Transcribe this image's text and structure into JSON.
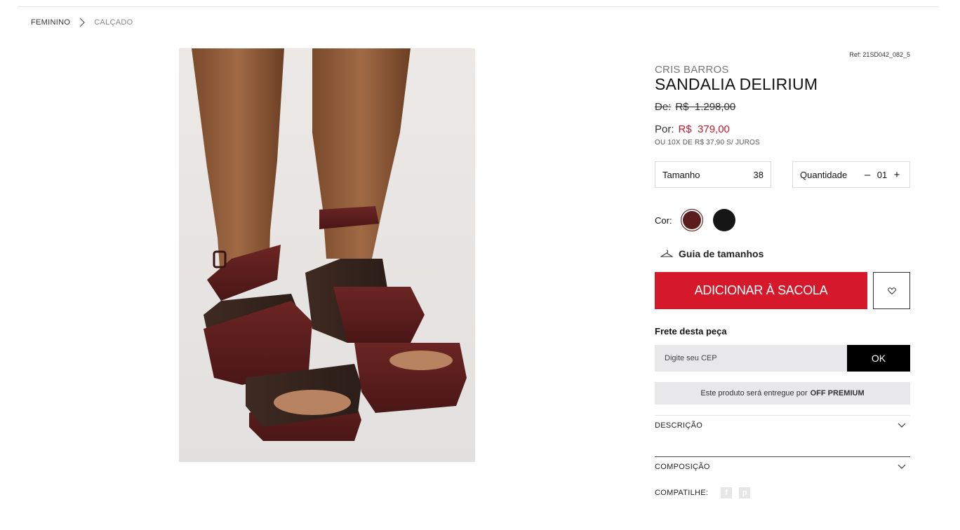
{
  "breadcrumb": {
    "items": [
      "FEMININO",
      "CALÇADO"
    ]
  },
  "product": {
    "ref": "Ref: 21SD042_082_5",
    "brand": "CRIS BARROS",
    "title": "SANDALIA DELIRIUM",
    "price_old_label": "De:",
    "price_old_value": "R$  1.298,00",
    "price_now_label": "Por:",
    "price_now_value": "R$  379,00",
    "installments": "OU 10X DE R$ 37,90 S/ JUROS"
  },
  "options": {
    "size_label": "Tamanho",
    "size_value": "38",
    "quantity_label": "Quantidade",
    "quantity_minus": "–",
    "quantity_value": "01",
    "quantity_plus": "+",
    "color_label": "Cor:",
    "colors": [
      {
        "name": "brown",
        "hex": "#5b1c1c",
        "selected": true
      },
      {
        "name": "black",
        "hex": "#161616",
        "selected": false
      }
    ]
  },
  "size_guide_label": "Guia de tamanhos",
  "add_to_bag_label": "ADICIONAR À SACOLA",
  "shipping": {
    "title": "Frete desta peça",
    "cep_placeholder": "Digite seu CEP",
    "ok_label": "OK",
    "delivery_note_prefix": "Este produto será entregue por",
    "delivery_note_seller": "OFF PREMIUM"
  },
  "accordions": {
    "description_label": "DESCRIÇÃO",
    "composition_label": "COMPOSIÇÃO"
  },
  "share": {
    "label": "COMPATILHE:",
    "icons": [
      "facebook-icon",
      "pinterest-icon"
    ],
    "facebook_glyph": "f",
    "pinterest_glyph": "p"
  },
  "colors": {
    "accent_red": "#d6182b",
    "price_red": "#c8192b",
    "field_gray": "#e8e8ea"
  }
}
